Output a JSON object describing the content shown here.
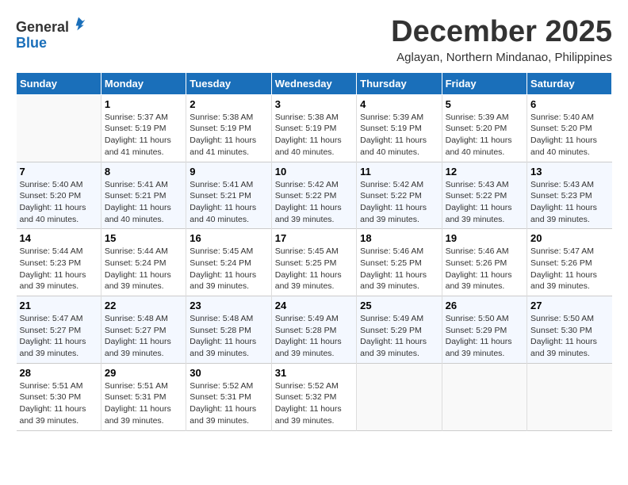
{
  "logo": {
    "general": "General",
    "blue": "Blue"
  },
  "title": {
    "month": "December 2025",
    "location": "Aglayan, Northern Mindanao, Philippines"
  },
  "headers": [
    "Sunday",
    "Monday",
    "Tuesday",
    "Wednesday",
    "Thursday",
    "Friday",
    "Saturday"
  ],
  "weeks": [
    [
      {
        "day": "",
        "info": ""
      },
      {
        "day": "1",
        "info": "Sunrise: 5:37 AM\nSunset: 5:19 PM\nDaylight: 11 hours\nand 41 minutes."
      },
      {
        "day": "2",
        "info": "Sunrise: 5:38 AM\nSunset: 5:19 PM\nDaylight: 11 hours\nand 41 minutes."
      },
      {
        "day": "3",
        "info": "Sunrise: 5:38 AM\nSunset: 5:19 PM\nDaylight: 11 hours\nand 40 minutes."
      },
      {
        "day": "4",
        "info": "Sunrise: 5:39 AM\nSunset: 5:19 PM\nDaylight: 11 hours\nand 40 minutes."
      },
      {
        "day": "5",
        "info": "Sunrise: 5:39 AM\nSunset: 5:20 PM\nDaylight: 11 hours\nand 40 minutes."
      },
      {
        "day": "6",
        "info": "Sunrise: 5:40 AM\nSunset: 5:20 PM\nDaylight: 11 hours\nand 40 minutes."
      }
    ],
    [
      {
        "day": "7",
        "info": "Sunrise: 5:40 AM\nSunset: 5:20 PM\nDaylight: 11 hours\nand 40 minutes."
      },
      {
        "day": "8",
        "info": "Sunrise: 5:41 AM\nSunset: 5:21 PM\nDaylight: 11 hours\nand 40 minutes."
      },
      {
        "day": "9",
        "info": "Sunrise: 5:41 AM\nSunset: 5:21 PM\nDaylight: 11 hours\nand 40 minutes."
      },
      {
        "day": "10",
        "info": "Sunrise: 5:42 AM\nSunset: 5:22 PM\nDaylight: 11 hours\nand 39 minutes."
      },
      {
        "day": "11",
        "info": "Sunrise: 5:42 AM\nSunset: 5:22 PM\nDaylight: 11 hours\nand 39 minutes."
      },
      {
        "day": "12",
        "info": "Sunrise: 5:43 AM\nSunset: 5:22 PM\nDaylight: 11 hours\nand 39 minutes."
      },
      {
        "day": "13",
        "info": "Sunrise: 5:43 AM\nSunset: 5:23 PM\nDaylight: 11 hours\nand 39 minutes."
      }
    ],
    [
      {
        "day": "14",
        "info": "Sunrise: 5:44 AM\nSunset: 5:23 PM\nDaylight: 11 hours\nand 39 minutes."
      },
      {
        "day": "15",
        "info": "Sunrise: 5:44 AM\nSunset: 5:24 PM\nDaylight: 11 hours\nand 39 minutes."
      },
      {
        "day": "16",
        "info": "Sunrise: 5:45 AM\nSunset: 5:24 PM\nDaylight: 11 hours\nand 39 minutes."
      },
      {
        "day": "17",
        "info": "Sunrise: 5:45 AM\nSunset: 5:25 PM\nDaylight: 11 hours\nand 39 minutes."
      },
      {
        "day": "18",
        "info": "Sunrise: 5:46 AM\nSunset: 5:25 PM\nDaylight: 11 hours\nand 39 minutes."
      },
      {
        "day": "19",
        "info": "Sunrise: 5:46 AM\nSunset: 5:26 PM\nDaylight: 11 hours\nand 39 minutes."
      },
      {
        "day": "20",
        "info": "Sunrise: 5:47 AM\nSunset: 5:26 PM\nDaylight: 11 hours\nand 39 minutes."
      }
    ],
    [
      {
        "day": "21",
        "info": "Sunrise: 5:47 AM\nSunset: 5:27 PM\nDaylight: 11 hours\nand 39 minutes."
      },
      {
        "day": "22",
        "info": "Sunrise: 5:48 AM\nSunset: 5:27 PM\nDaylight: 11 hours\nand 39 minutes."
      },
      {
        "day": "23",
        "info": "Sunrise: 5:48 AM\nSunset: 5:28 PM\nDaylight: 11 hours\nand 39 minutes."
      },
      {
        "day": "24",
        "info": "Sunrise: 5:49 AM\nSunset: 5:28 PM\nDaylight: 11 hours\nand 39 minutes."
      },
      {
        "day": "25",
        "info": "Sunrise: 5:49 AM\nSunset: 5:29 PM\nDaylight: 11 hours\nand 39 minutes."
      },
      {
        "day": "26",
        "info": "Sunrise: 5:50 AM\nSunset: 5:29 PM\nDaylight: 11 hours\nand 39 minutes."
      },
      {
        "day": "27",
        "info": "Sunrise: 5:50 AM\nSunset: 5:30 PM\nDaylight: 11 hours\nand 39 minutes."
      }
    ],
    [
      {
        "day": "28",
        "info": "Sunrise: 5:51 AM\nSunset: 5:30 PM\nDaylight: 11 hours\nand 39 minutes."
      },
      {
        "day": "29",
        "info": "Sunrise: 5:51 AM\nSunset: 5:31 PM\nDaylight: 11 hours\nand 39 minutes."
      },
      {
        "day": "30",
        "info": "Sunrise: 5:52 AM\nSunset: 5:31 PM\nDaylight: 11 hours\nand 39 minutes."
      },
      {
        "day": "31",
        "info": "Sunrise: 5:52 AM\nSunset: 5:32 PM\nDaylight: 11 hours\nand 39 minutes."
      },
      {
        "day": "",
        "info": ""
      },
      {
        "day": "",
        "info": ""
      },
      {
        "day": "",
        "info": ""
      }
    ]
  ]
}
